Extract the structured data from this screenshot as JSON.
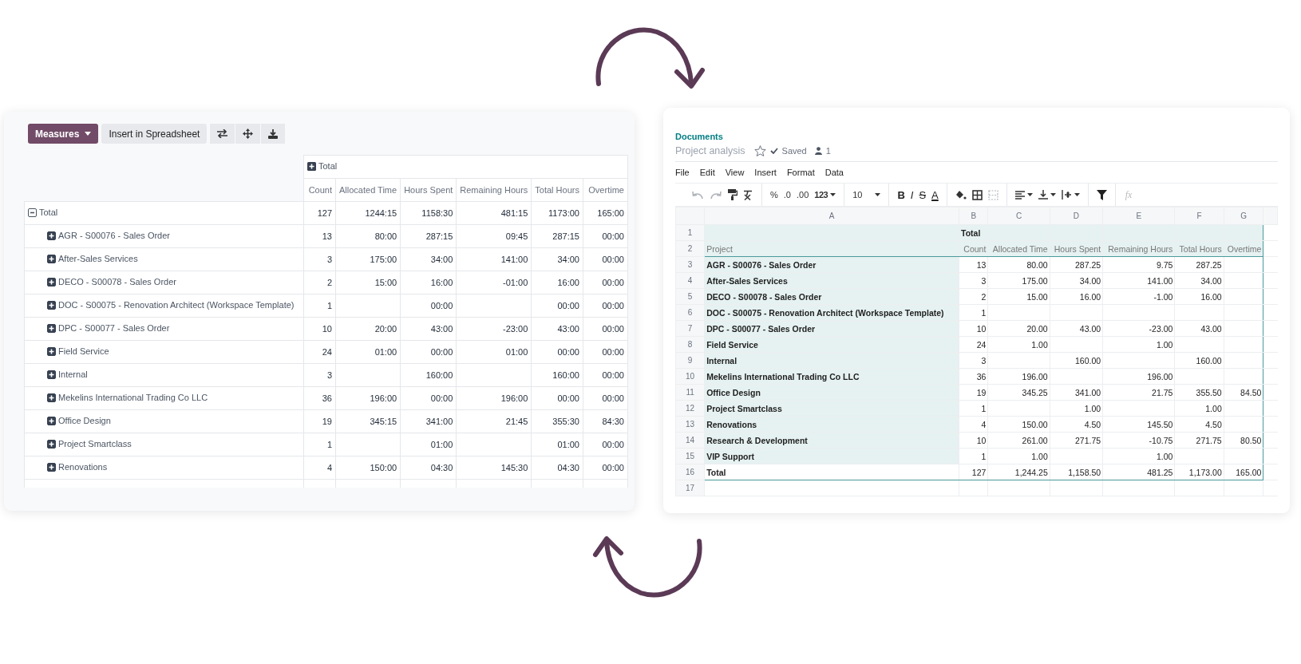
{
  "pivot": {
    "toolbar": {
      "measures": "Measures",
      "insert": "Insert in Spreadsheet"
    },
    "column_group": {
      "label": "Total",
      "expanded": false
    },
    "measures": [
      "Count",
      "Allocated Time",
      "Hours Spent",
      "Remaining Hours",
      "Total Hours",
      "Overtime"
    ],
    "rows": [
      {
        "label": "Total",
        "kind": "total",
        "expanded": true,
        "values": {
          "count": "127",
          "allocated_time": "1244:15",
          "hours_spent": "1158:30",
          "remaining_hours": "481:15",
          "total_hours": "1173:00",
          "overtime": "165:00"
        }
      },
      {
        "label": "AGR - S00076 - Sales Order",
        "kind": "group",
        "expanded": false,
        "values": {
          "count": "13",
          "allocated_time": "80:00",
          "hours_spent": "287:15",
          "remaining_hours": "09:45",
          "total_hours": "287:15",
          "overtime": "00:00"
        }
      },
      {
        "label": "After-Sales Services",
        "kind": "group",
        "expanded": false,
        "values": {
          "count": "3",
          "allocated_time": "175:00",
          "hours_spent": "34:00",
          "remaining_hours": "141:00",
          "total_hours": "34:00",
          "overtime": "00:00"
        }
      },
      {
        "label": "DECO - S00078 - Sales Order",
        "kind": "group",
        "expanded": false,
        "values": {
          "count": "2",
          "allocated_time": "15:00",
          "hours_spent": "16:00",
          "remaining_hours": "-01:00",
          "total_hours": "16:00",
          "overtime": "00:00"
        }
      },
      {
        "label": "DOC - S00075 - Renovation Architect (Workspace Template)",
        "kind": "group",
        "expanded": false,
        "values": {
          "count": "1",
          "hours_spent": "00:00",
          "total_hours": "00:00",
          "overtime": "00:00"
        }
      },
      {
        "label": "DPC - S00077 - Sales Order",
        "kind": "group",
        "expanded": false,
        "values": {
          "count": "10",
          "allocated_time": "20:00",
          "hours_spent": "43:00",
          "remaining_hours": "-23:00",
          "total_hours": "43:00",
          "overtime": "00:00"
        }
      },
      {
        "label": "Field Service",
        "kind": "group",
        "expanded": false,
        "values": {
          "count": "24",
          "allocated_time": "01:00",
          "hours_spent": "00:00",
          "remaining_hours": "01:00",
          "total_hours": "00:00",
          "overtime": "00:00"
        }
      },
      {
        "label": "Internal",
        "kind": "group",
        "expanded": false,
        "values": {
          "count": "3",
          "hours_spent": "160:00",
          "total_hours": "160:00",
          "overtime": "00:00"
        }
      },
      {
        "label": "Mekelins International Trading Co LLC",
        "kind": "group",
        "expanded": false,
        "values": {
          "count": "36",
          "allocated_time": "196:00",
          "hours_spent": "00:00",
          "remaining_hours": "196:00",
          "total_hours": "00:00",
          "overtime": "00:00"
        }
      },
      {
        "label": "Office Design",
        "kind": "group",
        "expanded": false,
        "values": {
          "count": "19",
          "allocated_time": "345:15",
          "hours_spent": "341:00",
          "remaining_hours": "21:45",
          "total_hours": "355:30",
          "overtime": "84:30"
        }
      },
      {
        "label": "Project Smartclass",
        "kind": "group",
        "expanded": false,
        "values": {
          "count": "1",
          "hours_spent": "01:00",
          "total_hours": "01:00",
          "overtime": "00:00"
        }
      },
      {
        "label": "Renovations",
        "kind": "group",
        "expanded": false,
        "values": {
          "count": "4",
          "allocated_time": "150:00",
          "hours_spent": "04:30",
          "remaining_hours": "145:30",
          "total_hours": "04:30",
          "overtime": "00:00"
        }
      }
    ]
  },
  "doc": {
    "breadcrumb": "Documents",
    "title": "Project analysis",
    "starred": false,
    "status": "Saved",
    "users": "1"
  },
  "menu": [
    "File",
    "Edit",
    "View",
    "Insert",
    "Format",
    "Data"
  ],
  "toolbar": {
    "number_formats": [
      "%",
      ".0",
      ".00"
    ],
    "format": "123",
    "font_size": "10",
    "styles": [
      "B",
      "I",
      "S",
      "A"
    ],
    "formula_hint": "fx"
  },
  "sheet": {
    "columns": [
      "A",
      "B",
      "C",
      "D",
      "E",
      "F",
      "G"
    ],
    "rows": [
      {
        "num": "1",
        "kind": "group",
        "cells": {
          "b": "Total"
        }
      },
      {
        "num": "2",
        "kind": "header",
        "cells": {
          "a": "Project",
          "b": "Count",
          "c": "Allocated Time",
          "d": "Hours Spent",
          "e": "Remaining Hours",
          "f": "Total Hours",
          "g": "Overtime"
        }
      },
      {
        "num": "3",
        "kind": "data",
        "cells": {
          "a": "AGR - S00076 - Sales Order",
          "b": "13",
          "c": "80.00",
          "d": "287.25",
          "e": "9.75",
          "f": "287.25"
        }
      },
      {
        "num": "4",
        "kind": "data",
        "cells": {
          "a": "After-Sales Services",
          "b": "3",
          "c": "175.00",
          "d": "34.00",
          "e": "141.00",
          "f": "34.00"
        }
      },
      {
        "num": "5",
        "kind": "data",
        "cells": {
          "a": "DECO - S00078 - Sales Order",
          "b": "2",
          "c": "15.00",
          "d": "16.00",
          "e": "-1.00",
          "f": "16.00"
        }
      },
      {
        "num": "6",
        "kind": "data",
        "cells": {
          "a": "DOC - S00075 - Renovation Architect (Workspace Template)",
          "b": "1"
        }
      },
      {
        "num": "7",
        "kind": "data",
        "cells": {
          "a": "DPC - S00077 - Sales Order",
          "b": "10",
          "c": "20.00",
          "d": "43.00",
          "e": "-23.00",
          "f": "43.00"
        }
      },
      {
        "num": "8",
        "kind": "data",
        "cells": {
          "a": "Field Service",
          "b": "24",
          "c": "1.00",
          "e": "1.00"
        }
      },
      {
        "num": "9",
        "kind": "data",
        "cells": {
          "a": "Internal",
          "b": "3",
          "d": "160.00",
          "f": "160.00"
        }
      },
      {
        "num": "10",
        "kind": "data",
        "cells": {
          "a": "Mekelins International Trading Co LLC",
          "b": "36",
          "c": "196.00",
          "e": "196.00"
        }
      },
      {
        "num": "11",
        "kind": "data",
        "cells": {
          "a": "Office Design",
          "b": "19",
          "c": "345.25",
          "d": "341.00",
          "e": "21.75",
          "f": "355.50",
          "g": "84.50"
        }
      },
      {
        "num": "12",
        "kind": "data",
        "cells": {
          "a": "Project Smartclass",
          "b": "1",
          "d": "1.00",
          "f": "1.00"
        }
      },
      {
        "num": "13",
        "kind": "data",
        "cells": {
          "a": "Renovations",
          "b": "4",
          "c": "150.00",
          "d": "4.50",
          "e": "145.50",
          "f": "4.50"
        }
      },
      {
        "num": "14",
        "kind": "data",
        "cells": {
          "a": "Research & Development",
          "b": "10",
          "c": "261.00",
          "d": "271.75",
          "e": "-10.75",
          "f": "271.75",
          "g": "80.50"
        }
      },
      {
        "num": "15",
        "kind": "data",
        "cells": {
          "a": "VIP Support",
          "b": "1",
          "c": "1.00",
          "e": "1.00"
        }
      },
      {
        "num": "16",
        "kind": "total",
        "cells": {
          "a": "Total",
          "b": "127",
          "c": "1,244.25",
          "d": "1,158.50",
          "e": "481.25",
          "f": "1,173.00",
          "g": "165.00"
        }
      },
      {
        "num": "17",
        "kind": "empty"
      }
    ]
  }
}
